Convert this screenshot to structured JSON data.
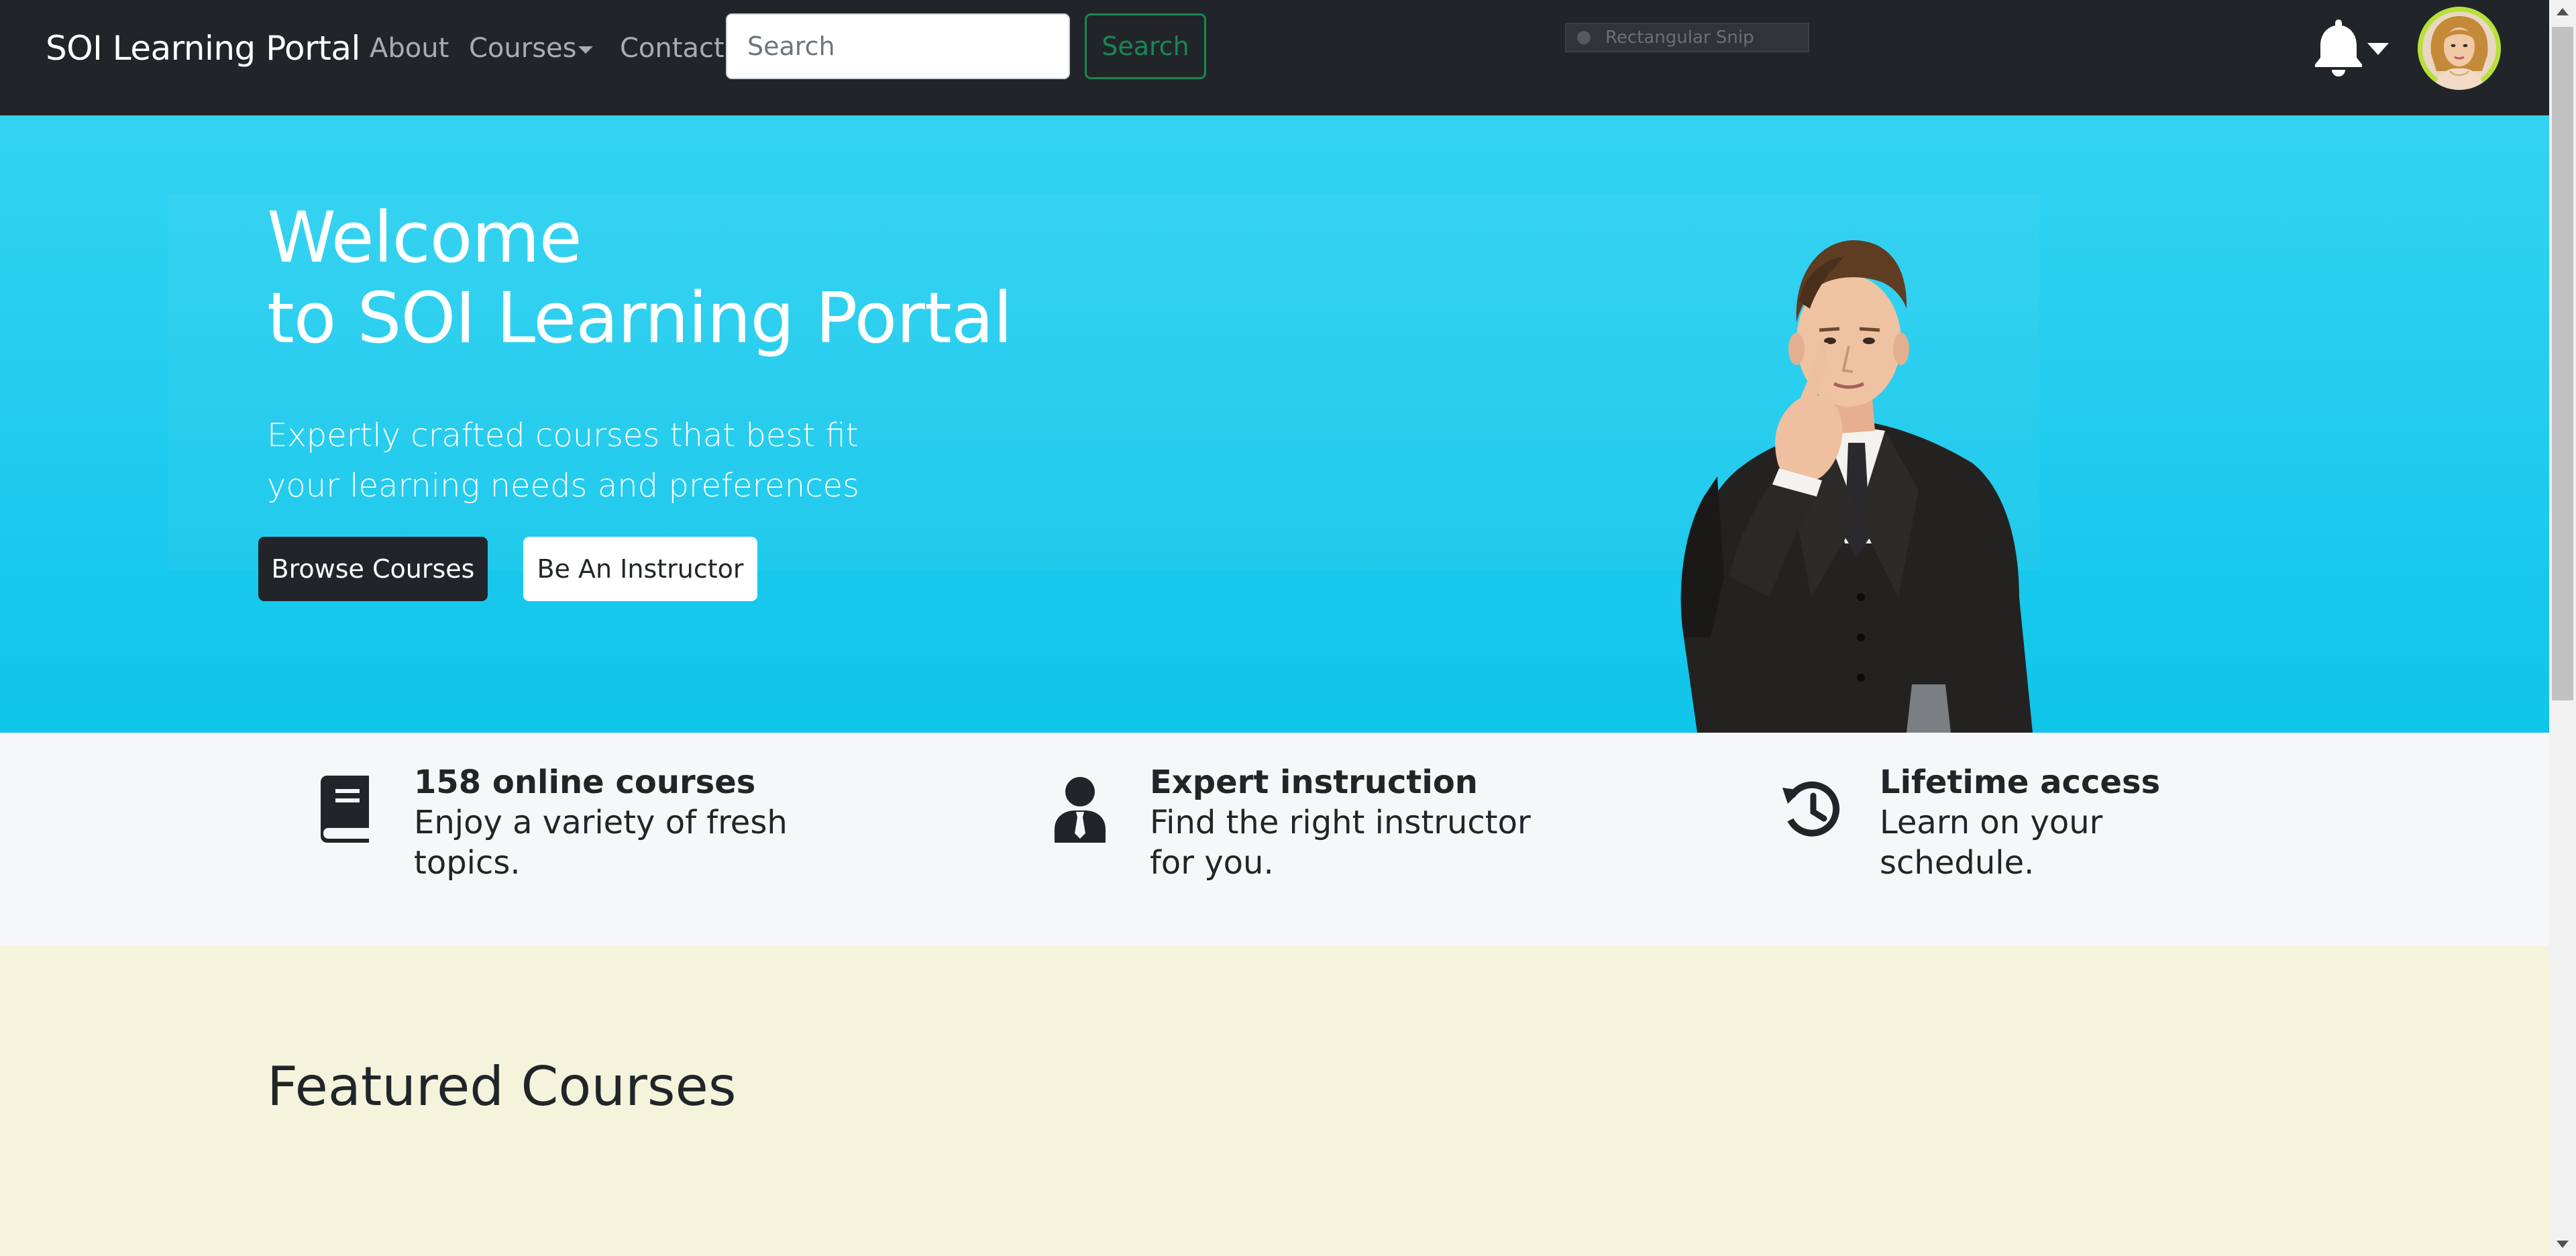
{
  "navbar": {
    "brand": "SOI Learning Portal",
    "links": {
      "about": "About",
      "courses": "Courses",
      "contact": "Contact"
    },
    "search": {
      "placeholder": "Search",
      "button_label": "Search"
    },
    "snip_label": "Rectangular Snip",
    "icons": {
      "notifications": "bell-icon",
      "dropdown": "caret-down-icon",
      "avatar": "user-avatar"
    }
  },
  "hero": {
    "title_line1": "Welcome",
    "title_line2": "to SOI Learning Portal",
    "subtitle_line1": "Expertly crafted courses that best fit",
    "subtitle_line2": "your learning needs and preferences",
    "browse_button": "Browse Courses",
    "instructor_button": "Be An Instructor"
  },
  "features": [
    {
      "icon": "book-icon",
      "title": "158 online courses",
      "desc_line1": "Enjoy a variety of fresh",
      "desc_line2": "topics."
    },
    {
      "icon": "user-tie-icon",
      "title": "Expert instruction",
      "desc_line1": "Find the right instructor",
      "desc_line2": "for you."
    },
    {
      "icon": "history-icon",
      "title": "Lifetime access",
      "desc_line1": "Learn on your",
      "desc_line2": "schedule."
    }
  ],
  "featured": {
    "title": "Featured Courses"
  },
  "colors": {
    "navbar_bg": "#212529",
    "hero_bg": "#22cdf0",
    "search_green": "#198754",
    "features_bg": "#f6f7f9",
    "featured_bg": "#f4f4dc",
    "avatar_ring": "#b8e03a"
  }
}
